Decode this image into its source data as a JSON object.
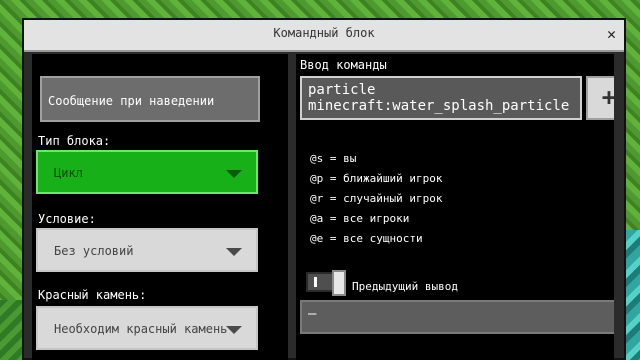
{
  "window": {
    "title": "Командный блок",
    "close_label": "✕"
  },
  "left": {
    "hover_message": "Сообщение при наведении",
    "block_type_label": "Тип блока:",
    "block_type_value": "Цикл",
    "condition_label": "Условие:",
    "condition_value": "Без условий",
    "redstone_label": "Красный камень:",
    "redstone_value": "Необходим красный камень"
  },
  "right": {
    "command_label": "Ввод команды",
    "command_line1": "particle",
    "command_line2": "minecraft:water_splash_particle",
    "plus_label": "+",
    "help": [
      "@s = вы",
      "@p = ближайший игрок",
      "@r = случайный игрок",
      "@a = все игроки",
      "@e = все сущности"
    ],
    "previous_output_label": "Предыдущий вывод",
    "output_value": "–"
  },
  "colors": {
    "accent_green": "#18b018",
    "panel": "#000000",
    "titlebar": "#e3e3e3"
  }
}
